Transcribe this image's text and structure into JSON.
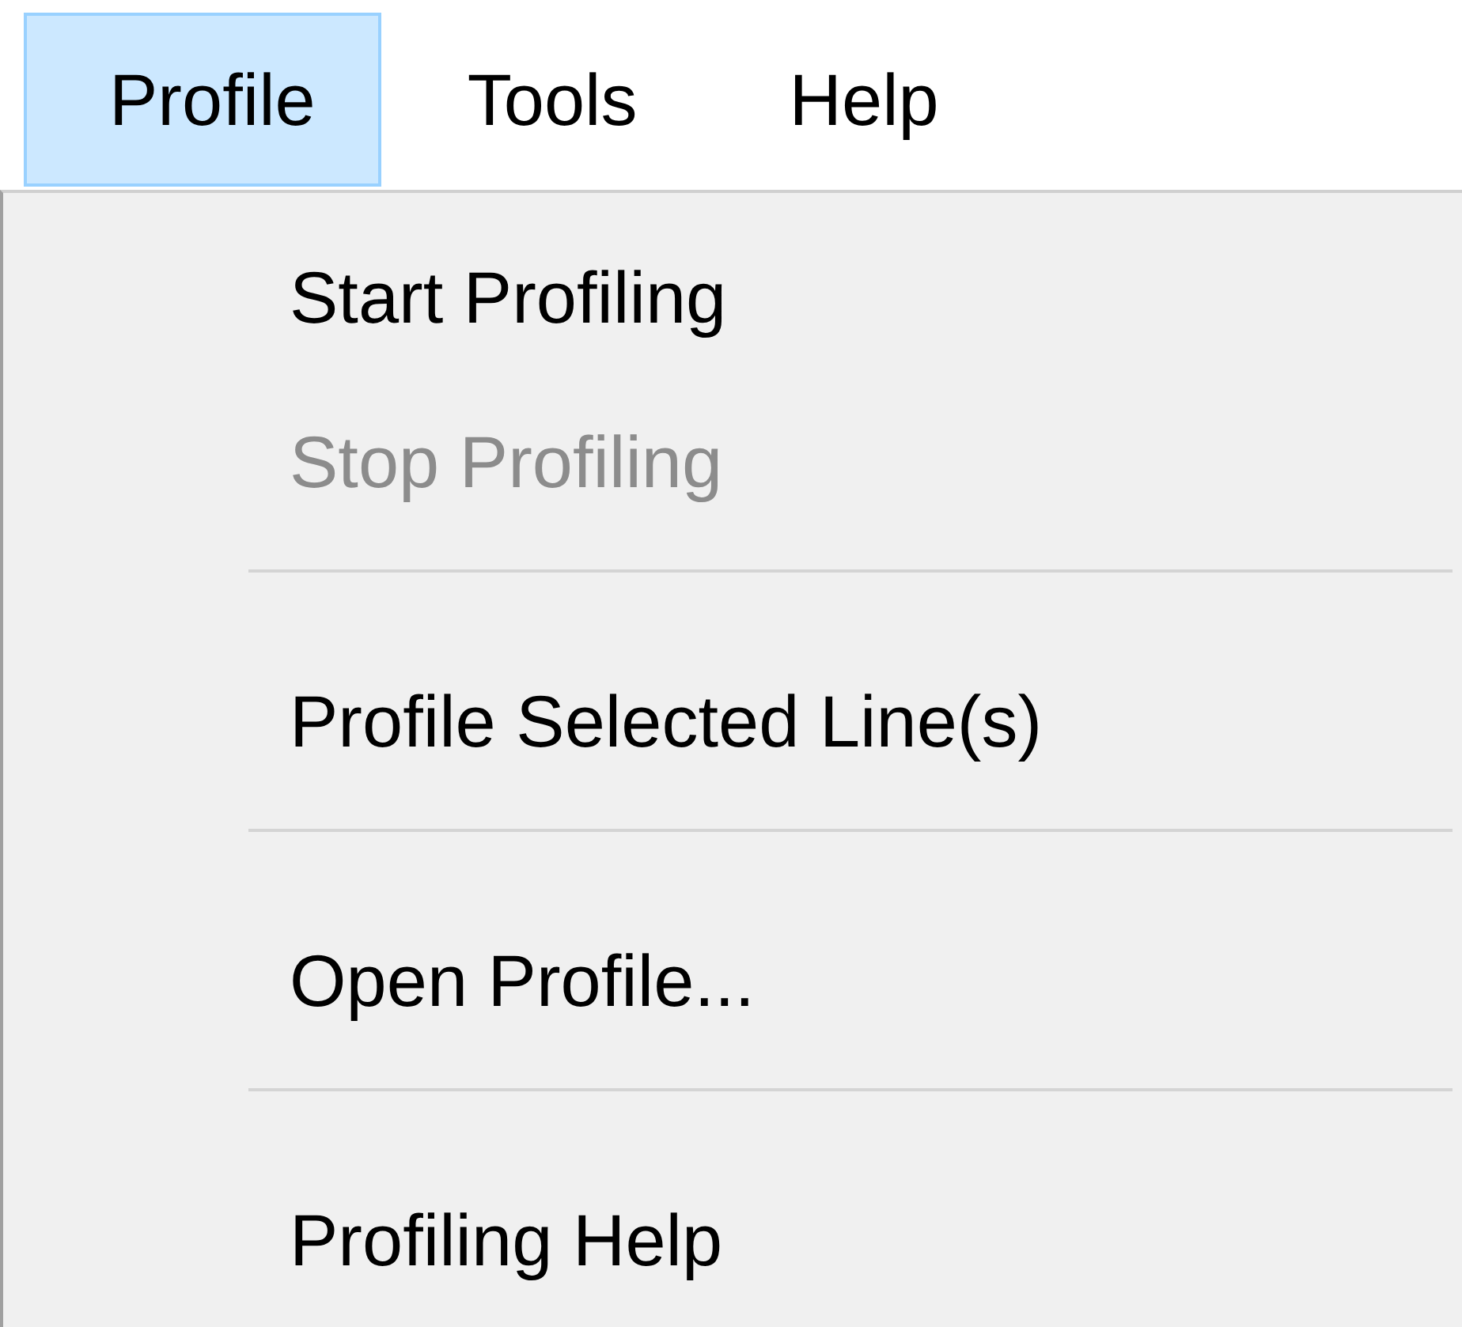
{
  "menu_bar": [
    {
      "label": "Profile",
      "selected": true
    },
    {
      "label": "Tools",
      "selected": false
    },
    {
      "label": "Help",
      "selected": false
    }
  ],
  "menu": [
    {
      "kind": "item",
      "label": "Start Profiling",
      "disabled": false
    },
    {
      "kind": "item",
      "label": "Stop Profiling",
      "disabled": true
    },
    {
      "kind": "separator"
    },
    {
      "kind": "item",
      "label": "Profile Selected Line(s)",
      "disabled": false
    },
    {
      "kind": "separator"
    },
    {
      "kind": "item",
      "label": "Open Profile...",
      "disabled": false
    },
    {
      "kind": "separator"
    },
    {
      "kind": "item",
      "label": "Profiling Help",
      "disabled": false
    }
  ]
}
